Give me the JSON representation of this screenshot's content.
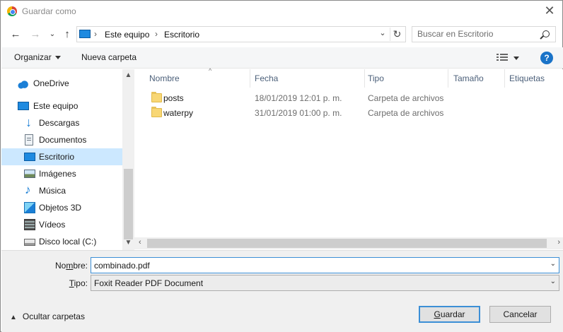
{
  "window": {
    "title": "Guardar como"
  },
  "address": {
    "crumbs": [
      "Este equipo",
      "Escritorio"
    ]
  },
  "search": {
    "placeholder": "Buscar en Escritorio"
  },
  "toolbar": {
    "organize_label": "Organizar",
    "new_folder_label": "Nueva carpeta"
  },
  "sidebar": {
    "items": [
      {
        "label": "OneDrive",
        "icon": "cloud-icon"
      },
      {
        "label": "Este equipo",
        "icon": "computer-icon"
      },
      {
        "label": "Descargas",
        "icon": "downloads-icon"
      },
      {
        "label": "Documentos",
        "icon": "documents-icon"
      },
      {
        "label": "Escritorio",
        "icon": "desktop-icon",
        "selected": true
      },
      {
        "label": "Imágenes",
        "icon": "pictures-icon"
      },
      {
        "label": "Música",
        "icon": "music-icon"
      },
      {
        "label": "Objetos 3D",
        "icon": "3d-objects-icon"
      },
      {
        "label": "Vídeos",
        "icon": "videos-icon"
      },
      {
        "label": "Disco local (C:)",
        "icon": "local-disk-icon"
      }
    ]
  },
  "columns": [
    "Nombre",
    "Fecha",
    "Tipo",
    "Tamaño",
    "Etiquetas"
  ],
  "files": [
    {
      "name": "posts",
      "date": "18/01/2019 12:01 p. m.",
      "type": "Carpeta de archivos"
    },
    {
      "name": "waterpy",
      "date": "31/01/2019 01:00 p. m.",
      "type": "Carpeta de archivos"
    }
  ],
  "form": {
    "name_label_pre": "No",
    "name_label_ul": "m",
    "name_label_post": "bre:",
    "name_value": "combinado.pdf",
    "type_label_ul": "T",
    "type_label_post": "ipo:",
    "type_value": "Foxit Reader PDF Document"
  },
  "footer": {
    "hide_folders_label": "Ocultar carpetas",
    "save_label": "Guardar",
    "save_label_ul": "G",
    "save_label_rest": "uardar",
    "cancel_label": "Cancelar"
  },
  "colors": {
    "accent": "#3c8fd6",
    "selection": "#cce8ff",
    "help": "#1a73c8"
  }
}
